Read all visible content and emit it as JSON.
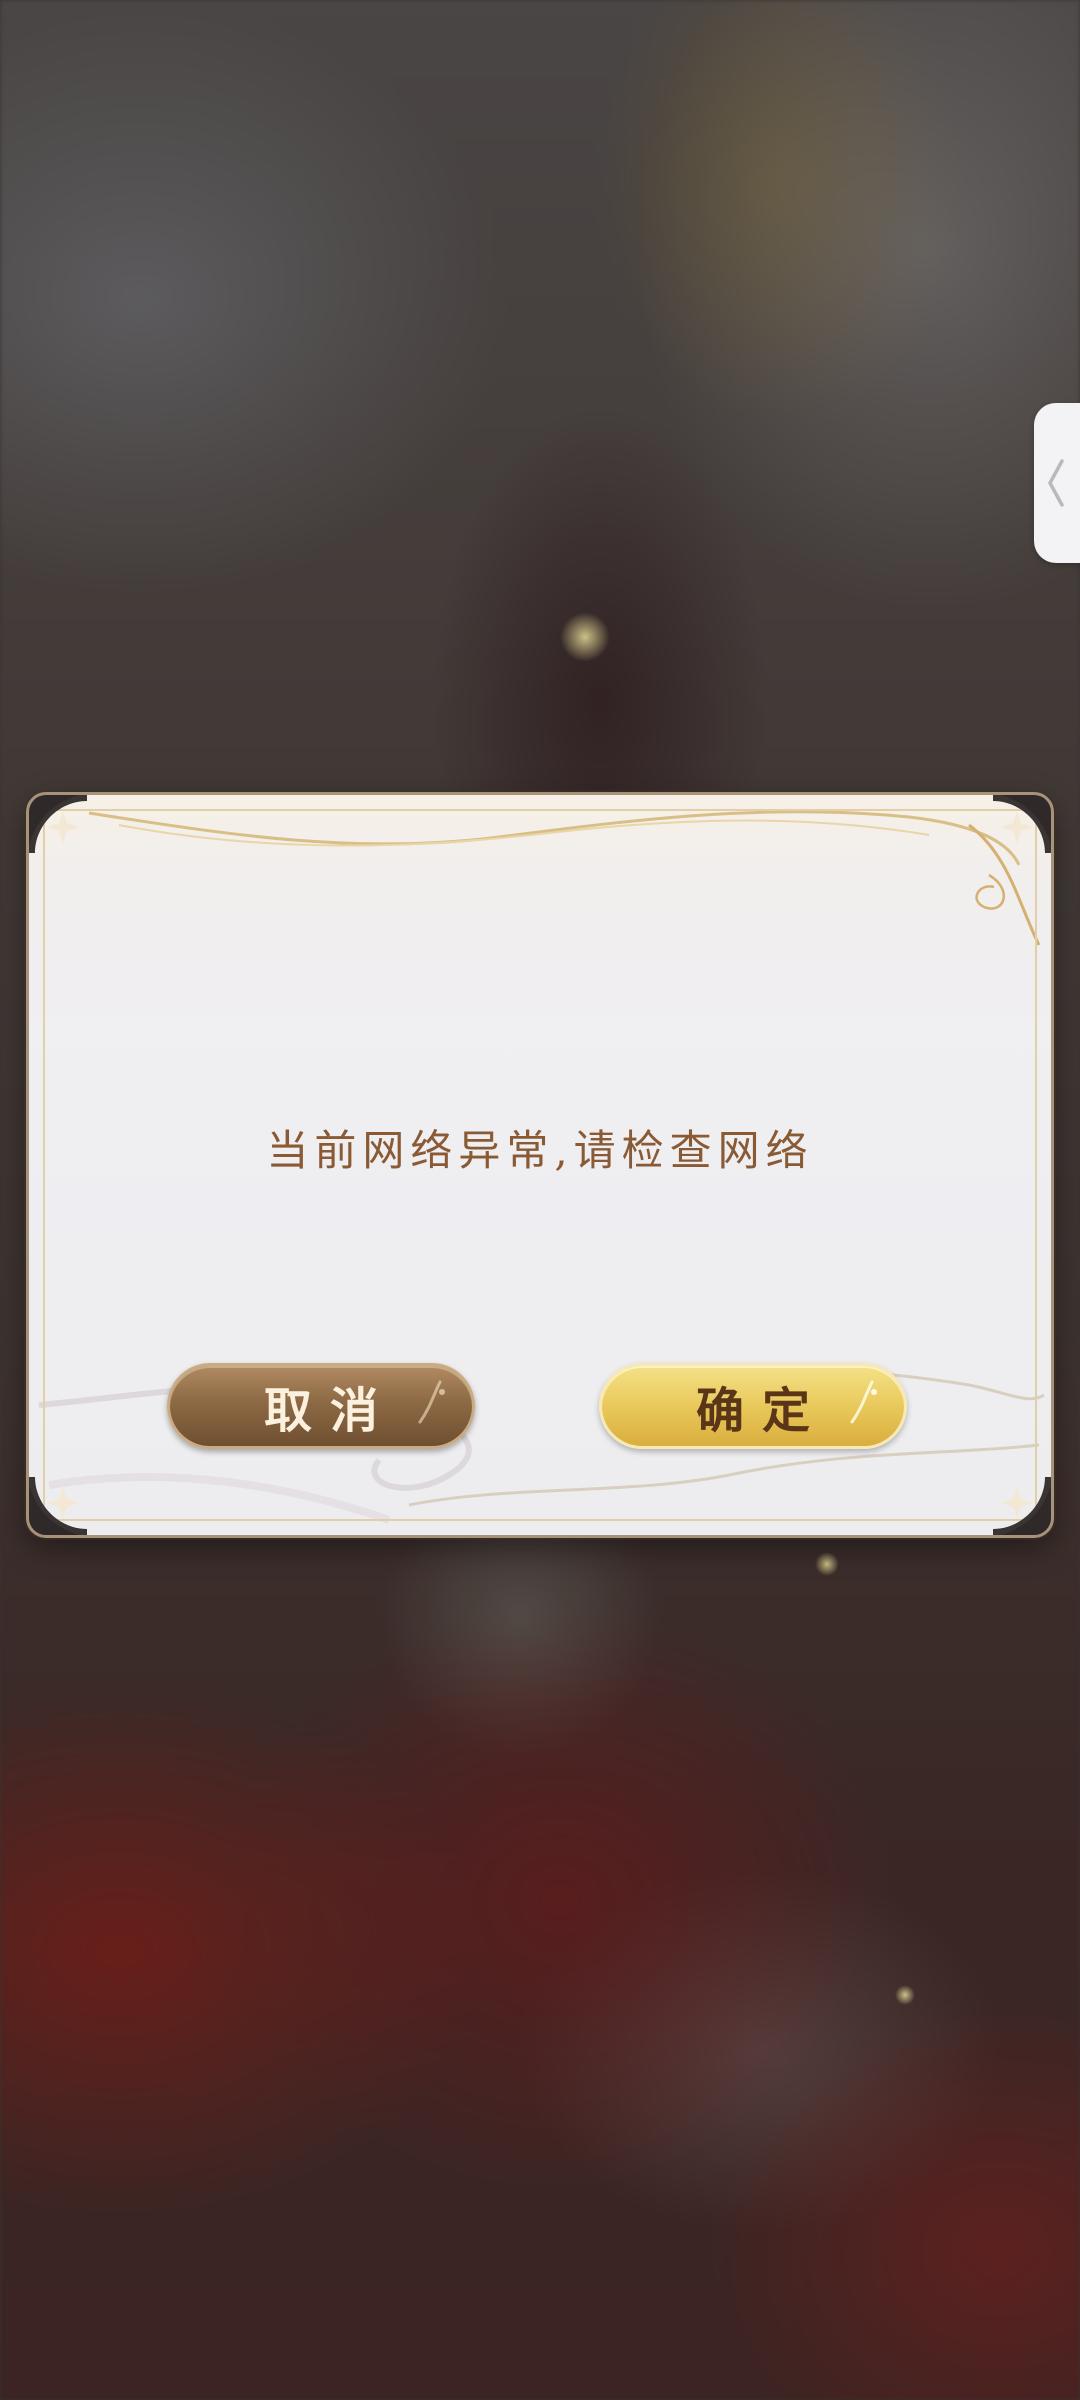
{
  "dialog": {
    "message": "当前网络异常,请检查网络",
    "cancel_label": "取消",
    "confirm_label": "确定"
  },
  "side_tab": {
    "icon": "chevron-left-icon"
  },
  "colors": {
    "message_text": "#8a5a34",
    "cancel_button": "#8d6a45",
    "confirm_button": "#e9c95b",
    "dialog_background": "#efeff2",
    "frame_gold": "#e2cfa8"
  }
}
